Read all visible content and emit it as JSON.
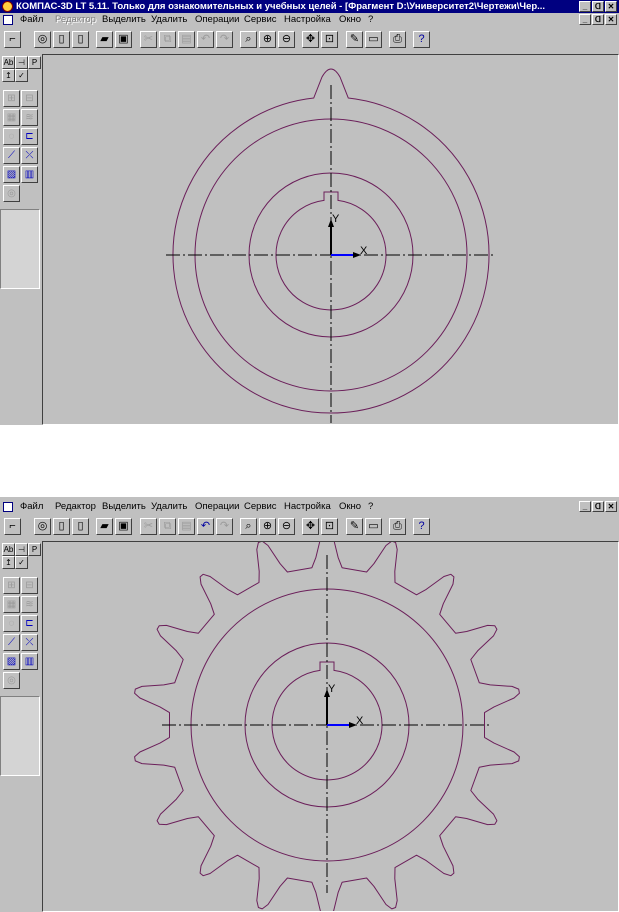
{
  "window": {
    "title": "КОМПАС-3D LT 5.11. Только для ознакомительных и учебных целей - [Фрагмент D:\\Университет2\\Чертежи\\Чер...",
    "controls": {
      "minimize": "_",
      "maximize": "ᗡ",
      "close": "✕"
    }
  },
  "menu": {
    "items": [
      {
        "label": "Файл",
        "enabled": true
      },
      {
        "label": "Редактор",
        "enabled": true
      },
      {
        "label": "Выделить",
        "enabled": true
      },
      {
        "label": "Удалить",
        "enabled": true
      },
      {
        "label": "Операции",
        "enabled": true
      },
      {
        "label": "Сервис",
        "enabled": true
      },
      {
        "label": "Настройка",
        "enabled": true
      },
      {
        "label": "Окно",
        "enabled": true
      },
      {
        "label": "?",
        "enabled": true
      }
    ],
    "first_view_disabled_item": "Редактор"
  },
  "toolbar": {
    "icons": [
      "pointer-icon",
      "camera-icon",
      "new-doc-icon",
      "blank-doc-icon",
      "open-folder-icon",
      "save-icon",
      "cut-icon",
      "copy-icon",
      "paste-icon",
      "undo-icon",
      "redo-icon",
      "zoom-window-icon",
      "zoom-in-icon",
      "zoom-out-icon",
      "pan-icon",
      "zoom-all-icon",
      "draw-icon",
      "panel-icon",
      "print-preview-icon",
      "help-icon"
    ]
  },
  "left_tools": {
    "small_labels": [
      "Ab",
      "P"
    ],
    "icons": [
      "text-icon",
      "bracket-icon",
      "param-icon",
      "cursor-icon",
      "check-icon",
      "geometry-icon",
      "dimension-icon",
      "mark-icon",
      "layer-icon",
      "circle-icon",
      "edit-icon",
      "line-icon",
      "intersect-icon",
      "hatch-icon",
      "library-icon",
      "spiral-icon"
    ]
  },
  "views": [
    {
      "id": "hub-without-teeth",
      "teeth": 0,
      "title_visible": true
    },
    {
      "id": "gear-with-teeth",
      "teeth": 18,
      "title_visible": false
    }
  ],
  "drawing": {
    "axis_x_label": "X",
    "axis_y_label": "Y",
    "line_color": "#6b1f5a",
    "axis_color": "#000000",
    "origin_color": "#0000ff"
  }
}
